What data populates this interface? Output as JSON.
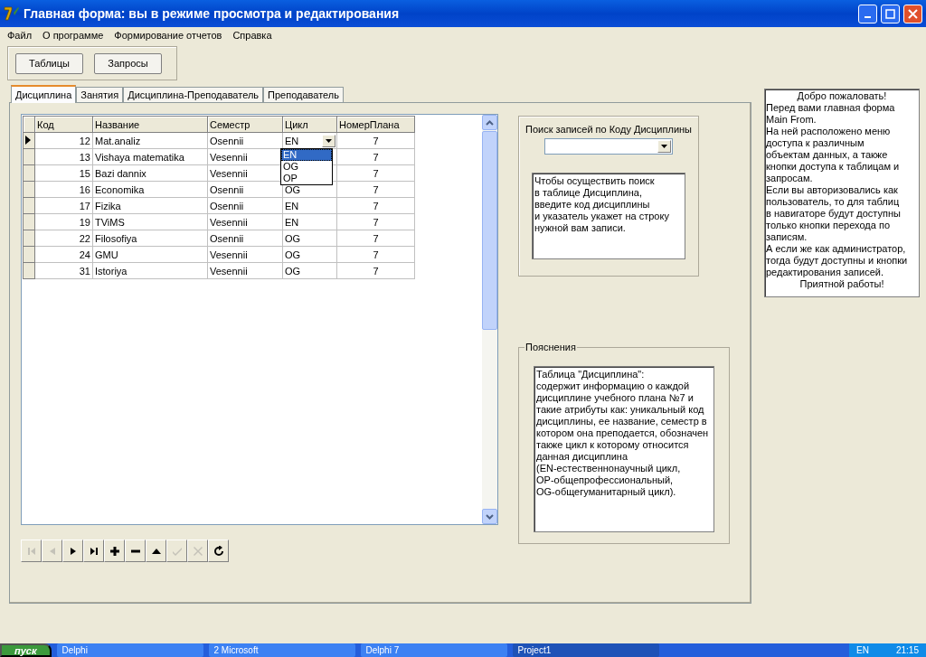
{
  "window": {
    "title": "Главная форма: вы в режиме просмотра и редактирования"
  },
  "menu": [
    "Файл",
    "О программе",
    "Формирование отчетов",
    "Справка"
  ],
  "toolbar_buttons": [
    "Таблицы",
    "Запросы"
  ],
  "tabs": [
    {
      "label": "Дисциплина",
      "selected": true
    },
    {
      "label": "Занятия",
      "selected": false
    },
    {
      "label": "Дисциплина-Преподаватель",
      "selected": false
    },
    {
      "label": "Преподаватель",
      "selected": false
    }
  ],
  "grid": {
    "columns": [
      "Код",
      "Название",
      "Семестр",
      "Цикл",
      "НомерПлана"
    ],
    "rows": [
      {
        "code": "12",
        "name": "Mat.analiz",
        "semester": "Osennii",
        "plan": "7",
        "current": true,
        "editor": {
          "value": "EN",
          "options": [
            {
              "label": "EN",
              "selected": true
            },
            {
              "label": "OG",
              "selected": false
            },
            {
              "label": "OP",
              "selected": false
            }
          ]
        }
      },
      {
        "code": "13",
        "name": "Vishaya matematika",
        "semester": "Vesennii",
        "plan": "7",
        "current": false
      },
      {
        "code": "15",
        "name": "Bazi dannix",
        "semester": "Vesennii",
        "plan": "7",
        "current": false
      },
      {
        "code": "16",
        "name": "Economika",
        "semester": "Osennii",
        "cycle": "OG",
        "plan": "7",
        "current": false
      },
      {
        "code": "17",
        "name": "Fizika",
        "semester": "Osennii",
        "cycle": "EN",
        "plan": "7",
        "current": false
      },
      {
        "code": "19",
        "name": "TViMS",
        "semester": "Vesennii",
        "cycle": "EN",
        "plan": "7",
        "current": false
      },
      {
        "code": "22",
        "name": "Filosofiya",
        "semester": "Osennii",
        "cycle": "OG",
        "plan": "7",
        "current": false
      },
      {
        "code": "24",
        "name": "GMU",
        "semester": "Vesennii",
        "cycle": "OG",
        "plan": "7",
        "current": false
      },
      {
        "code": "31",
        "name": "Istoriya",
        "semester": "Vesennii",
        "cycle": "OG",
        "plan": "7",
        "current": false
      }
    ]
  },
  "navigator": [
    {
      "kind": "first",
      "disabled": true
    },
    {
      "kind": "prior",
      "disabled": true
    },
    {
      "kind": "next",
      "disabled": false
    },
    {
      "kind": "last",
      "disabled": false
    },
    {
      "kind": "insert",
      "disabled": false
    },
    {
      "kind": "delete",
      "disabled": false
    },
    {
      "kind": "edit",
      "disabled": false
    },
    {
      "kind": "post",
      "disabled": true
    },
    {
      "kind": "cancel",
      "disabled": true
    },
    {
      "kind": "refresh",
      "disabled": false
    }
  ],
  "search": {
    "label": "Поиск записей по Коду Дисциплины",
    "hint": "Чтобы осуществить поиск\nв таблице Дисциплина,\nвведите код дисциплины\nи указатель укажет на строку\nнужной вам записи."
  },
  "notes": {
    "title": "Пояснения",
    "text": "Таблица \"Дисциплина\":\nсодержит информацию о каждой\nдисциплине учебного плана №7 и\nтакие атрибуты как: уникальный код\nдисциплины, ее название, семестр в\nкотором она преподается, обозначен\nтакже цикл к которому относится\nданная дисциплина\n(EN-естественнонаучный цикл,\n OP-общепрофессиональный,\n OG-общегуманитарный цикл)."
  },
  "welcome": {
    "greeting": "Добро пожаловать!",
    "body": "Перед вами главная форма\nMain From.\nНа ней расположено меню\nдоступа к различным\nобъектам данных, а также\nкнопки доступа к таблицам и\nзапросам.\nЕсли вы авторизовались как\nпользователь, то для таблиц\nв навигаторе будут доступны\nтолько кнопки перехода по\nзаписям.\nА если же как администратор,\nтогда будут доступны и кнопки\nредактирования записей.",
    "closing": "Приятной работы!"
  },
  "taskbar": {
    "start": "пуск",
    "buttons": [
      {
        "label": "Delphi",
        "active": false
      },
      {
        "label": "2 Microsoft",
        "active": false
      },
      {
        "label": "Delphi 7",
        "active": false
      },
      {
        "label": "Project1",
        "active": true
      }
    ],
    "language": "EN",
    "clock": "21:15"
  }
}
